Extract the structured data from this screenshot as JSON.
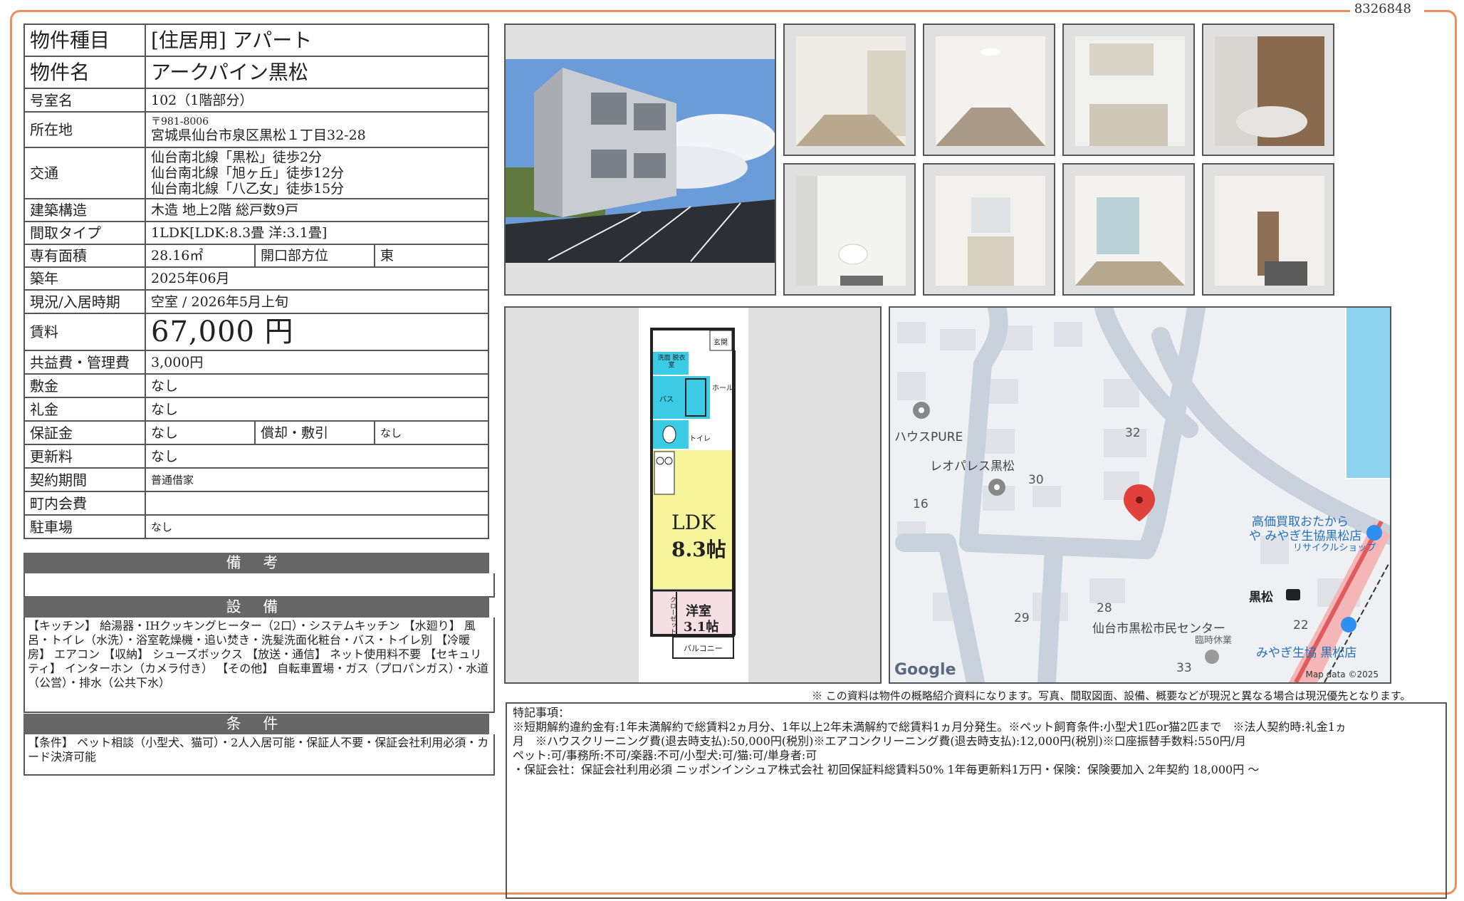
{
  "doc_id": "8326848",
  "property": {
    "type_label": "物件種目",
    "type_value": "[住居用]  アパート",
    "name_label": "物件名",
    "name_value": "アークパイン黒松",
    "room_label": "号室名",
    "room_value": "102（1階部分）",
    "address_label": "所在地",
    "address_zip": "〒981-8006",
    "address_value": "宮城県仙台市泉区黒松１丁目32-28",
    "access_label": "交通",
    "access": [
      "仙台南北線「黒松」徒歩2分",
      "仙台南北線「旭ヶ丘」徒歩12分",
      "仙台南北線「八乙女」徒歩15分"
    ],
    "structure_label": "建築構造",
    "structure_value": "木造  地上2階  総戸数9戸",
    "layout_label": "間取タイプ",
    "layout_value": "1LDK[LDK:8.3畳 洋:3.1畳]",
    "area_label": "専有面積",
    "area_value": "28.16㎡",
    "direction_label": "開口部方位",
    "direction_value": "東",
    "built_label": "築年",
    "built_value": "2025年06月",
    "status_label": "現況/入居時期",
    "status_value": "空室  /  2026年5月上旬",
    "rent_label": "賃料",
    "rent_value": "67,000 円",
    "fee_label": "共益費・管理費",
    "fee_value": "3,000円",
    "deposit_label": "敷金",
    "deposit_value": "なし",
    "key_money_label": "礼金",
    "key_money_value": "なし",
    "guarantee_label": "保証金",
    "guarantee_value": "なし",
    "amort_label": "償却・敷引",
    "amort_value": "なし",
    "renewal_label": "更新料",
    "renewal_value": "なし",
    "contract_label": "契約期間",
    "contract_value": "普通借家",
    "community_label": "町内会費",
    "community_value": "",
    "parking_label": "駐車場",
    "parking_value": "なし"
  },
  "remarks": {
    "title": "備 考",
    "text": ""
  },
  "equipment": {
    "title": "設 備",
    "text": "【キッチン】 給湯器・IHクッキングヒーター（2口）・システムキッチン 【水廻り】 風呂・トイレ（水洗）・浴室乾燥機・追い焚き・洗髪洗面化粧台・バス・トイレ別 【冷暖房】 エアコン 【収納】 シューズボックス 【放送・通信】 ネット使用料不要 【セキュリティ】 インターホン（カメラ付き） 【その他】 自転車置場・ガス（プロパンガス）・水道（公営）・排水（公共下水）"
  },
  "conditions": {
    "title": "条 件",
    "text": "【条件】 ペット相談（小型犬、猫可）・2人入居可能・保証人不要・保証会社利用必須・カード決済可能"
  },
  "floorplan": {
    "ldk_label": "LDK",
    "ldk_size": "8.3帖",
    "western_label": "洋室",
    "western_size": "3.1帖",
    "entrance": "玄関",
    "hall": "ホール",
    "bath": "バス",
    "toilet": "トイレ",
    "wash": "洗面 脱衣室",
    "closet": "クローゼット",
    "balcony": "バルコニー"
  },
  "map": {
    "labels": [
      "ハウスPURE",
      "レオパレス黒松",
      "32",
      "30",
      "16",
      "高価買取おたから",
      "や みやぎ生協黒松店",
      "リサイクルショップ",
      "黒松",
      "28",
      "29",
      "仙台市黒松市民センター",
      "臨時休業",
      "22",
      "みやぎ生協 黒松店",
      "33"
    ],
    "google": "Google",
    "attribution": "Map data ©2025"
  },
  "disclaimer": "※ この資料は物件の概略紹介資料になります。写真、間取図面、設備、概要などが現況と異なる場合は現況優先となります。",
  "special_notes": {
    "title": "特記事項：",
    "lines": [
      "※短期解約違約金有:1年未満解約で総賃料2ヵ月分、1年以上2年未満解約で総賃料1ヵ月分発生。※ペット飼育条件:小型犬1匹or猫2匹まで　※法人契約時:礼金1ヵ",
      "月　※ハウスクリーニング費(退去時支払):50,000円(税別)※エアコンクリーニング費(退去時支払):12,000円(税別)※口座振替手数料:550円/月",
      "ペット:可/事務所:不可/楽器:不可/小型犬:可/猫:可/単身者:可",
      "・保証会社：保証会社利用必須 ニッポンインシュア株式会社 初回保証料総賃料50% 1年毎更新料1万円・保険：保険要加入 2年契約 18,000円 〜"
    ]
  }
}
